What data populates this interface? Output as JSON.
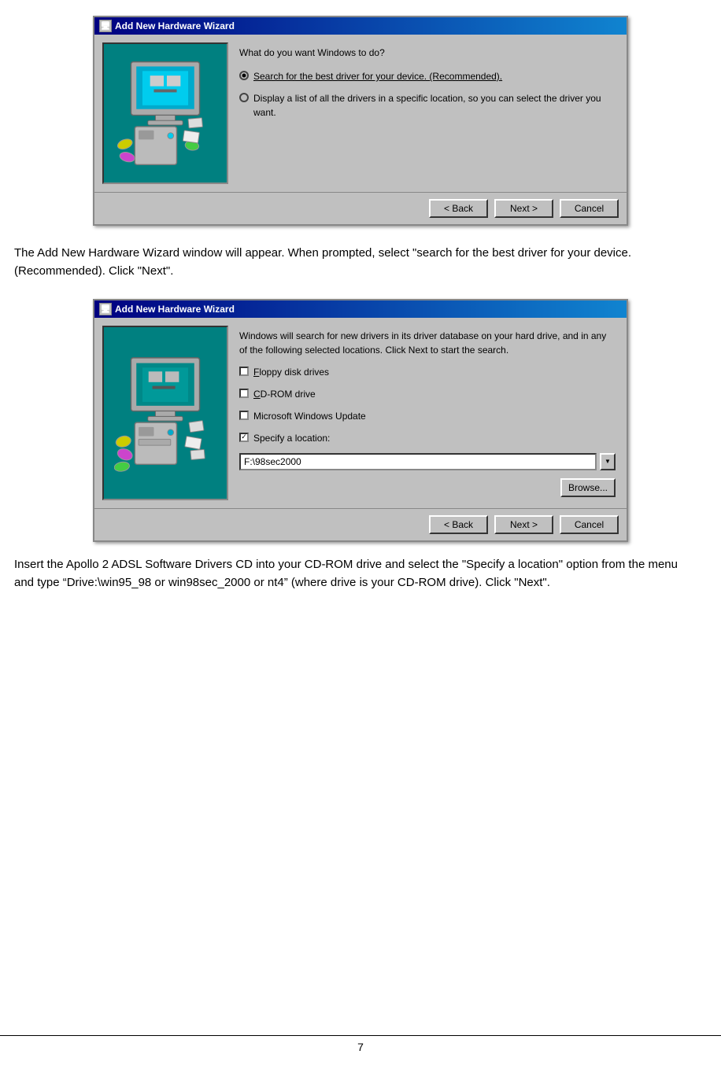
{
  "page": {
    "number": "7",
    "footer_line": true
  },
  "dialog1": {
    "title": "Add New Hardware Wizard",
    "question": "What do you want Windows to do?",
    "radio_options": [
      {
        "id": "radio1",
        "selected": true,
        "label": "Search for the best driver for your device. (Recommended)."
      },
      {
        "id": "radio2",
        "selected": false,
        "label": "Display a list of all the drivers in a specific location, so you can select the driver you want."
      }
    ],
    "buttons": {
      "back": "< Back",
      "next": "Next >",
      "cancel": "Cancel"
    }
  },
  "text1": "The Add New Hardware Wizard window will appear.  When prompted, select \"search for the best driver for your device.  (Recommended).  Click \"Next\".",
  "dialog2": {
    "title": "Add New Hardware Wizard",
    "description": "Windows will search for new drivers in its driver database on your hard drive, and in any of the following selected locations. Click Next to start the search.",
    "checkboxes": [
      {
        "id": "chk1",
        "checked": false,
        "label": "Floppy disk drives"
      },
      {
        "id": "chk2",
        "checked": false,
        "label": "CD-ROM drive"
      },
      {
        "id": "chk3",
        "checked": false,
        "label": "Microsoft Windows Update"
      },
      {
        "id": "chk4",
        "checked": true,
        "label": "Specify a location:"
      }
    ],
    "location_value": "F:\\98sec2000",
    "browse_label": "Browse...",
    "buttons": {
      "back": "< Back",
      "next": "Next >",
      "cancel": "Cancel"
    }
  },
  "text2": "Insert the Apollo 2 ADSL Software Drivers CD into your CD-ROM drive and select the \"Specify a location\" option from the menu and type “Drive:\\win95_98 or win98sec_2000 or nt4” (where drive is your CD-ROM drive).  Click \"Next\"."
}
